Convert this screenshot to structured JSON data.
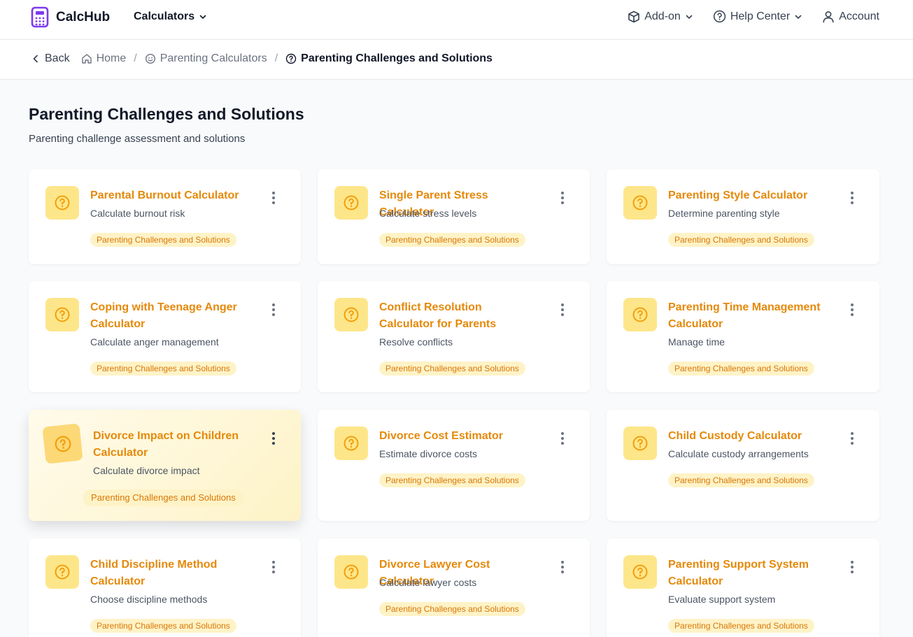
{
  "app": {
    "name": "CalcHub",
    "logo_icon": "calculator-icon",
    "accent": "#7c3aed"
  },
  "nav": {
    "calculators": "Calculators",
    "addon": "Add-on",
    "help": "Help Center",
    "account": "Account"
  },
  "breadcrumb": {
    "back": "Back",
    "home": "Home",
    "category": "Parenting Calculators",
    "current": "Parenting Challenges and Solutions"
  },
  "page": {
    "title": "Parenting Challenges and Solutions",
    "subtitle": "Parenting challenge assessment and solutions"
  },
  "colors": {
    "card_title": "#e5890a",
    "tag_bg": "#fef3c7",
    "tag_text": "#d97706",
    "icon_bg": "#fde68a"
  },
  "cards": [
    {
      "title": "Parental Burnout Calculator",
      "desc": "Calculate burnout risk",
      "tag": "Parenting Challenges and Solutions",
      "icon": "question-circle-icon"
    },
    {
      "title": "Single Parent Stress Calculator",
      "desc": "Calculate stress levels",
      "tag": "Parenting Challenges and Solutions",
      "icon": "question-circle-icon"
    },
    {
      "title": "Parenting Style Calculator",
      "desc": "Determine parenting style",
      "tag": "Parenting Challenges and Solutions",
      "icon": "question-circle-icon"
    },
    {
      "title": "Coping with Teenage Anger Calculator",
      "desc": "Calculate anger management",
      "tag": "Parenting Challenges and Solutions",
      "icon": "question-circle-icon"
    },
    {
      "title": "Conflict Resolution Calculator for Parents",
      "desc": "Resolve conflicts",
      "tag": "Parenting Challenges and Solutions",
      "icon": "question-circle-icon"
    },
    {
      "title": "Parenting Time Management Calculator",
      "desc": "Manage time",
      "tag": "Parenting Challenges and Solutions",
      "icon": "question-circle-icon"
    },
    {
      "title": "Divorce Impact on Children Calculator",
      "desc": "Calculate divorce impact",
      "tag": "Parenting Challenges and Solutions",
      "icon": "question-circle-icon",
      "hovered": true
    },
    {
      "title": "Divorce Cost Estimator",
      "desc": "Estimate divorce costs",
      "tag": "Parenting Challenges and Solutions",
      "icon": "question-circle-icon"
    },
    {
      "title": "Child Custody Calculator",
      "desc": "Calculate custody arrangements",
      "tag": "Parenting Challenges and Solutions",
      "icon": "question-circle-icon"
    },
    {
      "title": "Child Discipline Method Calculator",
      "desc": "Choose discipline methods",
      "tag": "Parenting Challenges and Solutions",
      "icon": "question-circle-icon"
    },
    {
      "title": "Divorce Lawyer Cost Calculator",
      "desc": "Calculate lawyer costs",
      "tag": "Parenting Challenges and Solutions",
      "icon": "question-circle-icon"
    },
    {
      "title": "Parenting Support System Calculator",
      "desc": "Evaluate support system",
      "tag": "Parenting Challenges and Solutions",
      "icon": "question-circle-icon"
    }
  ]
}
